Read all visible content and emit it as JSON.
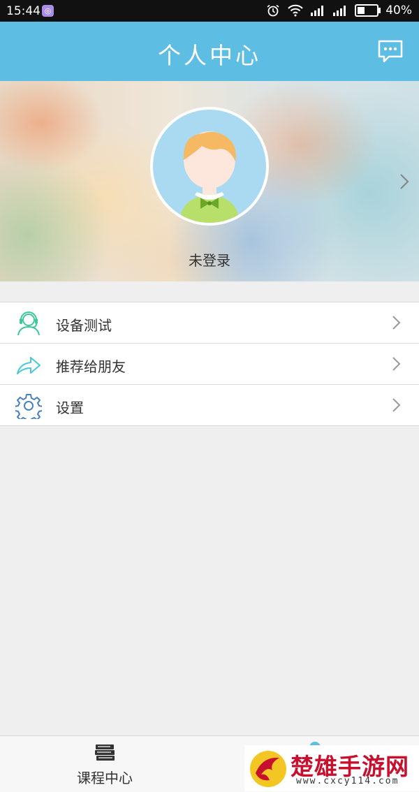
{
  "status_bar": {
    "time": "15:44",
    "battery": "40%",
    "battery_level": 0.4
  },
  "header": {
    "title": "个人中心"
  },
  "profile": {
    "username": "未登录"
  },
  "menu": {
    "items": [
      {
        "label": "设备测试",
        "icon": "headset-user-icon"
      },
      {
        "label": "推荐给朋友",
        "icon": "share-arrow-icon"
      },
      {
        "label": "设置",
        "icon": "gear-icon"
      }
    ]
  },
  "tabs": [
    {
      "label": "课程中心",
      "icon": "books-icon"
    }
  ],
  "watermark": {
    "title": "楚雄手游网",
    "url": "www.cxcy114.com"
  },
  "colors": {
    "accent": "#5ebde2",
    "menu_icon_green": "#3ec79a",
    "menu_icon_blue": "#4a80c0"
  }
}
